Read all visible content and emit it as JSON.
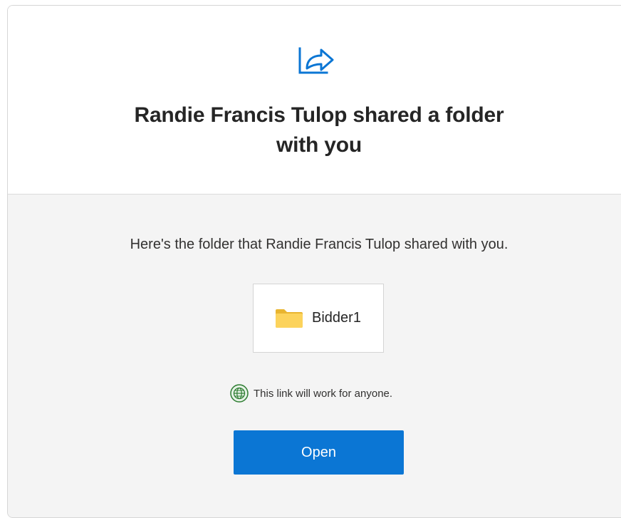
{
  "header": {
    "icon": "share-icon",
    "title_line1": "Randie Francis Tulop shared a folder",
    "title_line2": "with you"
  },
  "body": {
    "message": "Here's the folder that Randie Francis Tulop shared with you.",
    "folder": {
      "icon": "folder-icon",
      "name": "Bidder1"
    },
    "link_note": {
      "icon": "globe-icon",
      "text": "This link will work for anyone."
    },
    "open_button_label": "Open"
  },
  "colors": {
    "accent": "#0b76d4",
    "folder": "#f7c948",
    "globe": "#2e7d32",
    "background_body": "#f4f4f4",
    "title_text": "#252525"
  }
}
